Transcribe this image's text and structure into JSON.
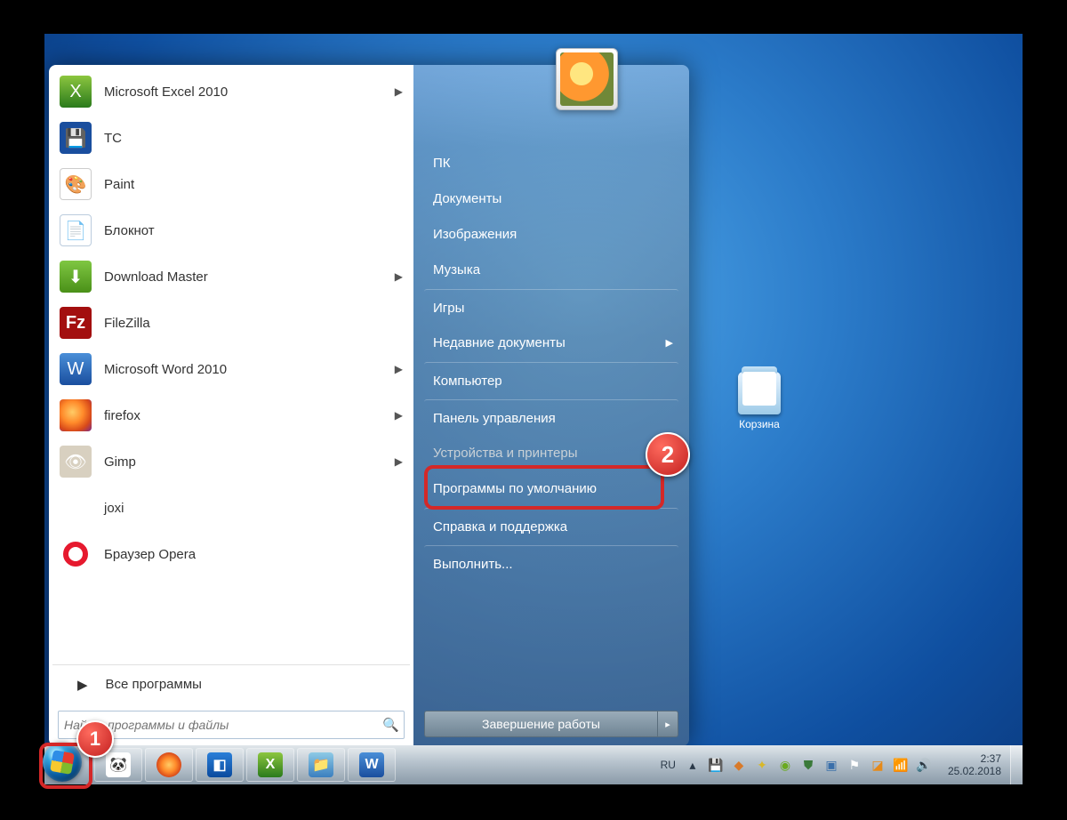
{
  "programs": [
    {
      "label": "Microsoft Excel 2010",
      "icon_name": "excel-icon",
      "icon_class": "ico-excel",
      "has_sub": true,
      "glyph": "X"
    },
    {
      "label": "TC",
      "icon_name": "totalcommander-icon",
      "icon_class": "ico-tc",
      "has_sub": false,
      "glyph": "💾"
    },
    {
      "label": "Paint",
      "icon_name": "paint-icon",
      "icon_class": "ico-paint",
      "has_sub": false,
      "glyph": "🎨"
    },
    {
      "label": "Блокнот",
      "icon_name": "notepad-icon",
      "icon_class": "ico-notepad",
      "has_sub": false,
      "glyph": "📄"
    },
    {
      "label": "Download Master",
      "icon_name": "downloadmaster-icon",
      "icon_class": "ico-dm",
      "has_sub": true,
      "glyph": "⬇"
    },
    {
      "label": "FileZilla",
      "icon_name": "filezilla-icon",
      "icon_class": "ico-fz",
      "has_sub": false,
      "glyph": "Fz"
    },
    {
      "label": "Microsoft Word 2010",
      "icon_name": "word-icon",
      "icon_class": "ico-word",
      "has_sub": true,
      "glyph": "W"
    },
    {
      "label": "firefox",
      "icon_name": "firefox-icon",
      "icon_class": "ico-ff",
      "has_sub": true,
      "glyph": ""
    },
    {
      "label": "Gimp",
      "icon_name": "gimp-icon",
      "icon_class": "ico-gimp",
      "has_sub": true,
      "glyph": "👁"
    },
    {
      "label": "joxi",
      "icon_name": "joxi-icon",
      "icon_class": "ico-joxi",
      "has_sub": false,
      "glyph": "✒"
    },
    {
      "label": "Браузер Opera",
      "icon_name": "opera-icon",
      "icon_class": "ico-opera",
      "has_sub": false,
      "glyph": ""
    }
  ],
  "all_programs": "Все программы",
  "search_placeholder": "Найти программы и файлы",
  "right_items": [
    {
      "label": "ПК",
      "name": "user-folder",
      "sep": false,
      "sub": false
    },
    {
      "label": "Документы",
      "name": "documents",
      "sep": false,
      "sub": false
    },
    {
      "label": "Изображения",
      "name": "pictures",
      "sep": false,
      "sub": false
    },
    {
      "label": "Музыка",
      "name": "music",
      "sep": false,
      "sub": false
    },
    {
      "label": "Игры",
      "name": "games",
      "sep": true,
      "sub": false
    },
    {
      "label": "Недавние документы",
      "name": "recent-docs",
      "sep": false,
      "sub": true
    },
    {
      "label": "Компьютер",
      "name": "computer",
      "sep": true,
      "sub": false
    },
    {
      "label": "Панель управления",
      "name": "control-panel",
      "sep": true,
      "sub": false,
      "highlight": true
    },
    {
      "label": "Устройства и принтеры",
      "name": "devices-printers",
      "sep": false,
      "sub": false,
      "dim": true
    },
    {
      "label": "Программы по умолчанию",
      "name": "default-programs",
      "sep": false,
      "sub": false
    },
    {
      "label": "Справка и поддержка",
      "name": "help-support",
      "sep": true,
      "sub": false
    },
    {
      "label": "Выполнить...",
      "name": "run",
      "sep": true,
      "sub": false
    }
  ],
  "shutdown_label": "Завершение работы",
  "recycle_label": "Корзина",
  "lang": "RU",
  "time": "2:37",
  "date": "25.02.2018",
  "ann1": "1",
  "ann2": "2",
  "taskbar_pins": [
    {
      "name": "mpc-icon",
      "bg": "linear-gradient(#fff,#fff)",
      "glyph": "🐼"
    },
    {
      "name": "firefox-tb-icon",
      "bg": "radial-gradient(#ffcc66,#ff8a2a 40%,#d84a1a 70%)",
      "glyph": ""
    },
    {
      "name": "teamviewer-icon",
      "bg": "linear-gradient(#2a7fd8,#0a4a9e)",
      "glyph": "◧"
    },
    {
      "name": "excel-tb-icon",
      "bg": "linear-gradient(#8cc63f,#2a7a1c)",
      "glyph": "X"
    },
    {
      "name": "explorer-icon",
      "bg": "linear-gradient(#8ecae6,#3a7fbf)",
      "glyph": "📁"
    },
    {
      "name": "word-tb-icon",
      "bg": "linear-gradient(#4a8fd8,#1a4e9e)",
      "glyph": "W"
    }
  ],
  "tray_icons": [
    {
      "name": "tray-up-icon",
      "glyph": "▴",
      "color": "#2a3948"
    },
    {
      "name": "tray-floppy-icon",
      "glyph": "💾",
      "color": "#1a4e9e"
    },
    {
      "name": "tray-app1-icon",
      "glyph": "◆",
      "color": "#d87a2a"
    },
    {
      "name": "tray-app2-icon",
      "glyph": "✦",
      "color": "#d8b82a"
    },
    {
      "name": "tray-nvidia-icon",
      "glyph": "◉",
      "color": "#6aaa1f"
    },
    {
      "name": "tray-shield-icon",
      "glyph": "⛊",
      "color": "#3a7a3a"
    },
    {
      "name": "tray-app3-icon",
      "glyph": "▣",
      "color": "#3a6faa"
    },
    {
      "name": "tray-flag-icon",
      "glyph": "⚑",
      "color": "#fff"
    },
    {
      "name": "tray-app4-icon",
      "glyph": "◪",
      "color": "#e68a1a"
    },
    {
      "name": "tray-network-icon",
      "glyph": "📶",
      "color": "#2a3948"
    },
    {
      "name": "tray-volume-icon",
      "glyph": "🔊",
      "color": "#2a3948"
    }
  ]
}
